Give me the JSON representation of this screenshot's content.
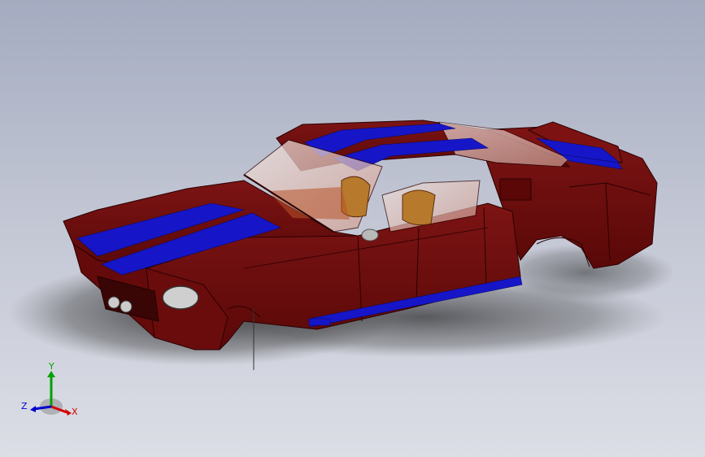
{
  "viewport": {
    "colors": {
      "body": "#6e0d0d",
      "stripe": "#1616c8",
      "glass": "#e4c9c3",
      "interior": "#b8542a",
      "seat": "#b77a2c",
      "mirror": "#b9b9b9",
      "shadow": "#2a2a2a"
    }
  },
  "triad": {
    "x_label": "X",
    "y_label": "Y",
    "z_label": "Z",
    "x_color": "#d40000",
    "y_color": "#00a000",
    "z_color": "#0000d0"
  }
}
